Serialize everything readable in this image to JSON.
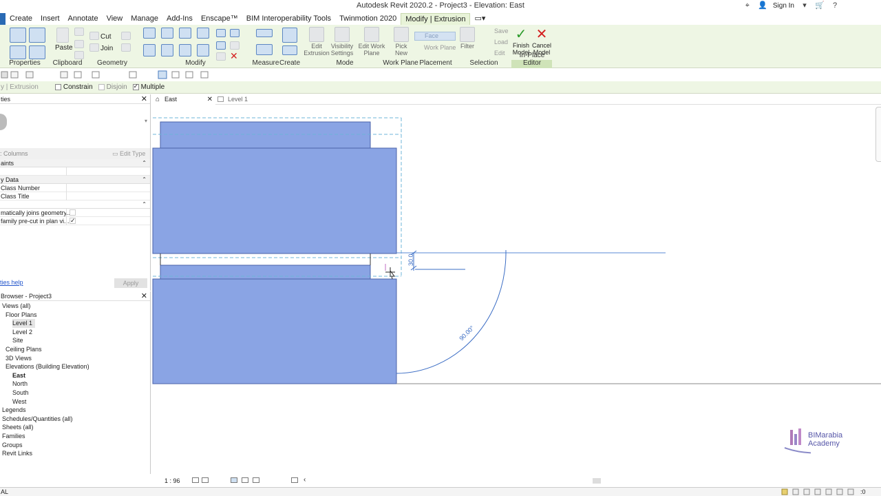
{
  "window": {
    "title": "Autodesk Revit 2020.2 - Project3 - Elevation: East",
    "sign_in": "Sign In"
  },
  "tabs": [
    "Create",
    "Insert",
    "Annotate",
    "View",
    "Manage",
    "Add-Ins",
    "Enscape™",
    "BIM Interoperability Tools",
    "Twinmotion 2020",
    "Modify | Extrusion"
  ],
  "active_tab": "Modify | Extrusion",
  "ribbon": {
    "groups": [
      "Properties",
      "Clipboard",
      "Geometry",
      "Modify",
      "Measure",
      "Create",
      "Mode",
      "Work Plane",
      "Placement",
      "Selection",
      "In-Place Editor"
    ],
    "clipboard": {
      "paste": "Paste",
      "cut": "Cut",
      "join": "Join"
    },
    "mode": {
      "edit_extrusion": "Edit Extrusion",
      "visibility_settings": "Visibility Settings",
      "edit_work_plane": "Edit Work Plane"
    },
    "workplane": {
      "pick_new": "Pick New"
    },
    "placement": {
      "face": "Face",
      "work_plane": "Work Plane"
    },
    "selection": {
      "filter": "Filter",
      "save": "Save",
      "load": "Load",
      "edit": "Edit"
    },
    "editor": {
      "finish": "Finish Model",
      "cancel": "Cancel Model"
    }
  },
  "options_bar": {
    "context": "y | Extrusion",
    "constrain": "Constrain",
    "disjoin": "Disjoin",
    "multiple": "Multiple"
  },
  "properties": {
    "header": "ties",
    "type_selector": ": Columns",
    "edit_type": "Edit Type",
    "sections": [
      {
        "title": "aints",
        "rows": []
      },
      {
        "title": "y Data",
        "rows": [
          "Class Number",
          "Class Title"
        ]
      },
      {
        "title": "",
        "rows": [
          "matically joins geometry...",
          "family pre-cut in plan vi..."
        ]
      }
    ],
    "help": "ties help",
    "apply": "Apply"
  },
  "browser": {
    "header": "Browser - Project3",
    "items": [
      {
        "label": "Views (all)",
        "indent": 0
      },
      {
        "label": "Floor Plans",
        "indent": 1
      },
      {
        "label": "Level 1",
        "indent": 3,
        "selected": true
      },
      {
        "label": "Level 2",
        "indent": 3
      },
      {
        "label": "Site",
        "indent": 3
      },
      {
        "label": "Ceiling Plans",
        "indent": 1
      },
      {
        "label": "3D Views",
        "indent": 1
      },
      {
        "label": "Elevations (Building Elevation)",
        "indent": 1
      },
      {
        "label": "East",
        "indent": 3,
        "bold": true
      },
      {
        "label": "North",
        "indent": 3
      },
      {
        "label": "South",
        "indent": 3
      },
      {
        "label": "West",
        "indent": 3
      },
      {
        "label": "Legends",
        "indent": 0
      },
      {
        "label": "Schedules/Quantities (all)",
        "indent": 0
      },
      {
        "label": "Sheets (all)",
        "indent": 0
      },
      {
        "label": "Families",
        "indent": 0
      },
      {
        "label": "Groups",
        "indent": 0
      },
      {
        "label": "Revit Links",
        "indent": 0
      }
    ]
  },
  "view_tabs": [
    {
      "label": "East",
      "active": true
    },
    {
      "label": "Level 1",
      "active": false
    }
  ],
  "canvas": {
    "dim_height": "30.0",
    "dim_angle": "90.00°",
    "fill_color": "#8aa4e4"
  },
  "view_bar": {
    "scale": "1 : 96"
  },
  "status": {
    "left": "AL",
    "right": ":0"
  },
  "logo": {
    "line1": "BIMarabia",
    "line2": "Academy"
  }
}
